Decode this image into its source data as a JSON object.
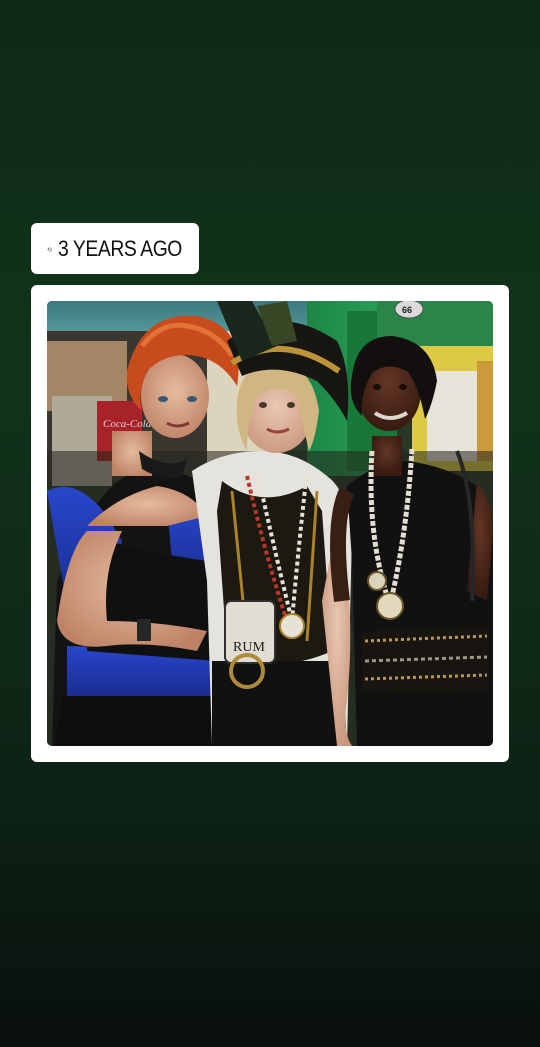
{
  "memory": {
    "label": "3 YEARS AGO",
    "icon": "history-icon"
  },
  "photo": {
    "alt": "Three women in pirate costumes",
    "sign_label": "66",
    "flask_text": "RUM",
    "cooler_text": "Coca-Cola"
  },
  "colors": {
    "background_top": "#123319",
    "background_bottom": "#0a0f0d",
    "card": "#ffffff"
  }
}
